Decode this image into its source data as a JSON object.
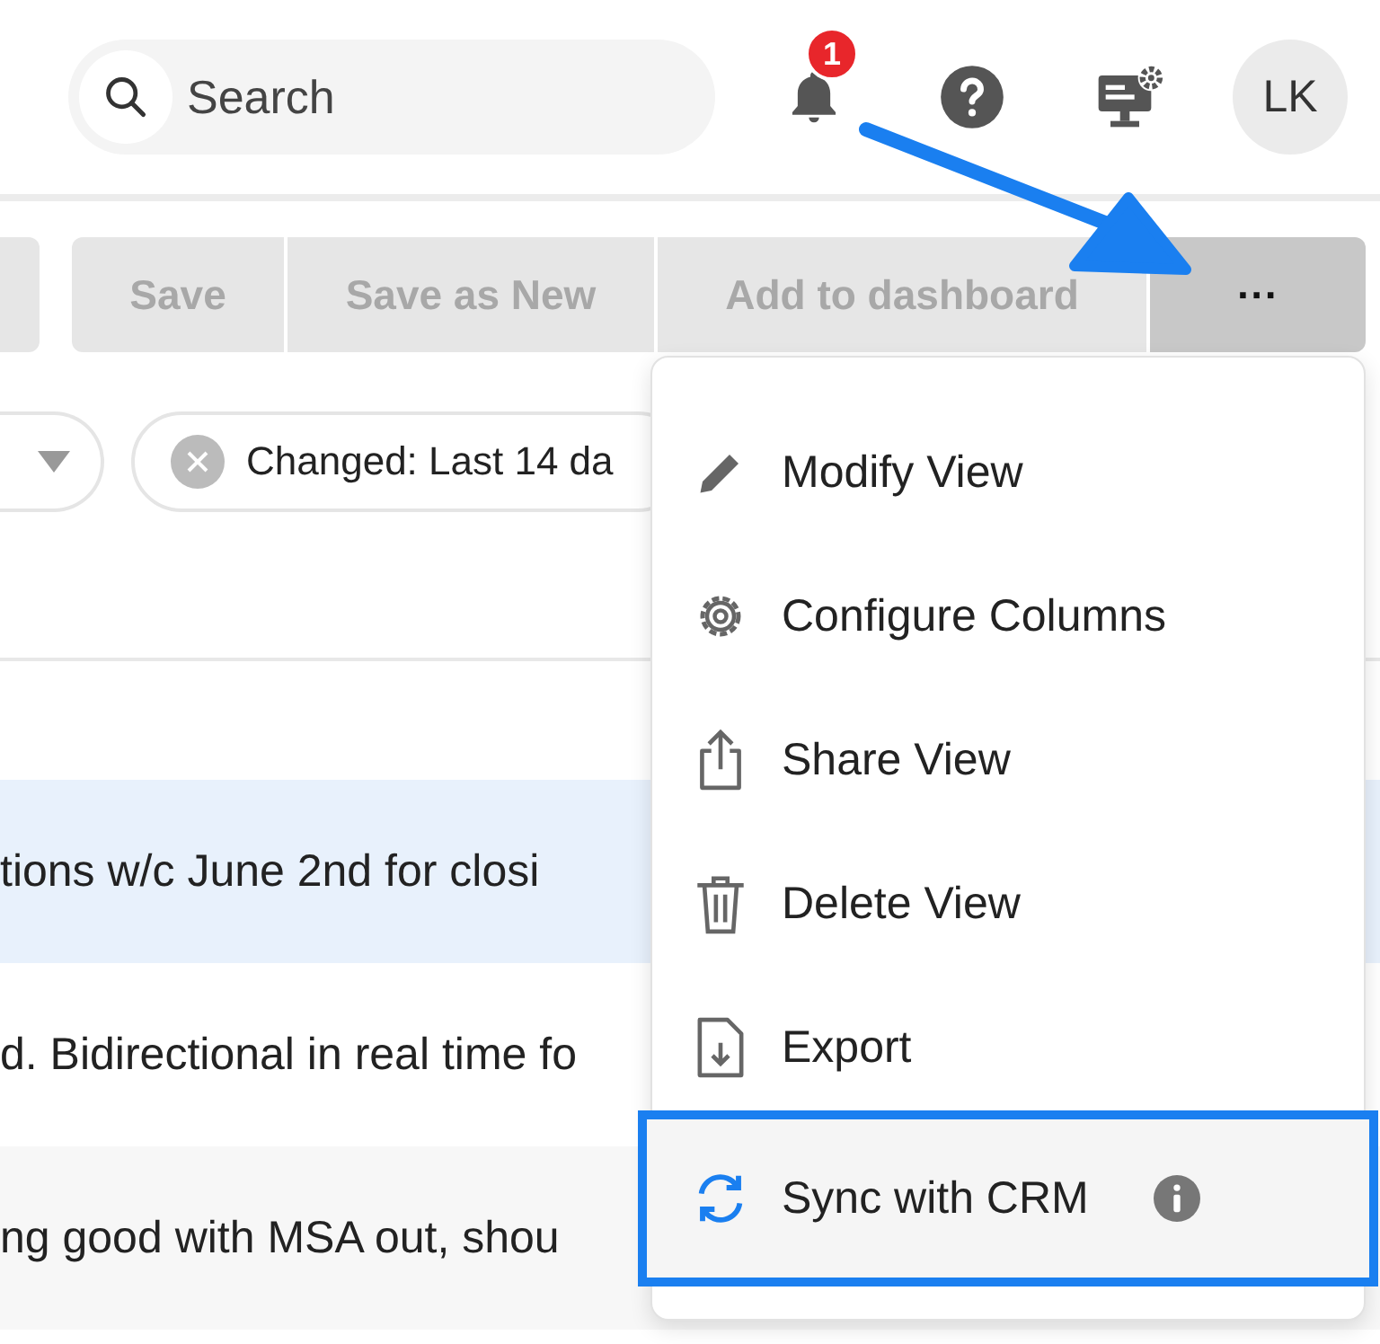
{
  "header": {
    "search": {
      "placeholder": "Search"
    },
    "notifications": {
      "count": "1"
    },
    "avatar": {
      "initials": "LK"
    }
  },
  "toolbar": {
    "buttons": [
      {
        "label": "Save",
        "disabled": true
      },
      {
        "label": "Save as New",
        "disabled": true
      },
      {
        "label": "Add to dashboard",
        "disabled": true
      },
      {
        "label": "···",
        "disabled": false
      }
    ]
  },
  "filters": {
    "chips": [
      {
        "label": "Changed: Last 14 da"
      }
    ]
  },
  "table": {
    "rows": [
      {
        "text": "tions w/c June 2nd for closi",
        "selected": true
      },
      {
        "text": "d. Bidirectional in real time fo",
        "selected": false
      },
      {
        "text": "ng good with MSA out, shou",
        "selected": false
      }
    ]
  },
  "menu": {
    "items": [
      {
        "kind": "edit",
        "label": "Modify View",
        "selected": false
      },
      {
        "kind": "gear",
        "label": "Configure Columns",
        "selected": false
      },
      {
        "kind": "share",
        "label": "Share View",
        "selected": false
      },
      {
        "kind": "trash",
        "label": "Delete View",
        "selected": false
      },
      {
        "kind": "export",
        "label": "Export",
        "selected": false
      },
      {
        "kind": "sync",
        "label": "Sync with CRM",
        "selected": true,
        "info": true
      }
    ]
  }
}
